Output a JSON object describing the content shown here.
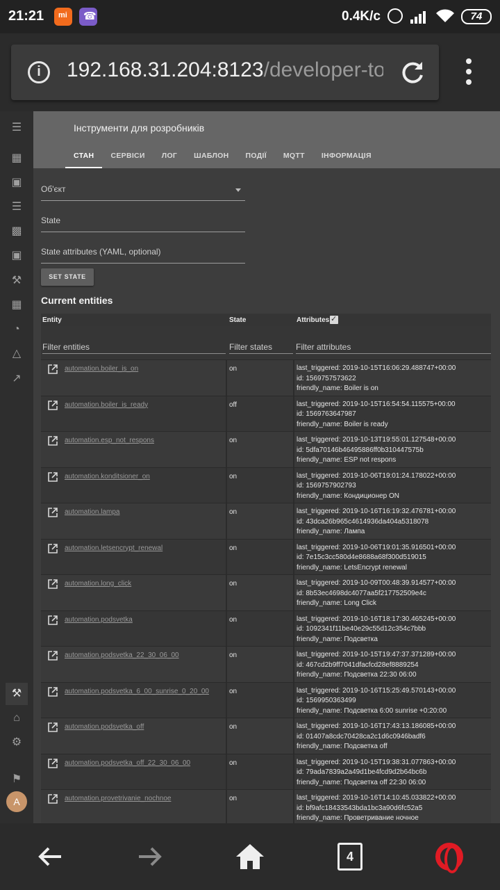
{
  "status_bar": {
    "time": "21:21",
    "net_speed": "0.4K/c",
    "battery": "74"
  },
  "browser": {
    "url_host": "192.168.31.204:8123",
    "url_path": "/developer-to"
  },
  "toolbar": {
    "title": "Інструменти для розробників",
    "tabs": [
      "СТАН",
      "СЕРВІСИ",
      "ЛОГ",
      "ШАБЛОН",
      "ПОДІЇ",
      "MQTT",
      "ІНФОРМАЦІЯ"
    ]
  },
  "form": {
    "entity_label": "Об'єкт",
    "state_label": "State",
    "attributes_label": "State attributes (YAML, optional)",
    "set_state_button": "SET STATE"
  },
  "entities": {
    "title": "Current entities",
    "columns": {
      "entity": "Entity",
      "state": "State",
      "attributes": "Attributes"
    },
    "filters": {
      "entity": "Filter entities",
      "state": "Filter states",
      "attributes": "Filter attributes"
    },
    "rows": [
      {
        "entity": "automation.boiler_is_on",
        "state": "on",
        "attr1": "last_triggered: 2019-10-15T16:06:29.488747+00:00",
        "attr2": "id: 1569757573622",
        "attr3": "friendly_name: Boiler is on"
      },
      {
        "entity": "automation.boiler_is_ready",
        "state": "off",
        "attr1": "last_triggered: 2019-10-15T16:54:54.115575+00:00",
        "attr2": "id: 1569763647987",
        "attr3": "friendly_name: Boiler is ready"
      },
      {
        "entity": "automation.esp_not_respons",
        "state": "on",
        "attr1": "last_triggered: 2019-10-13T19:55:01.127548+00:00",
        "attr2": "id: 5dfa70146b46495886ff0b310447575b",
        "attr3": "friendly_name: ESP not respons"
      },
      {
        "entity": "automation.konditsioner_on",
        "state": "on",
        "attr1": "last_triggered: 2019-10-06T19:01:24.178022+00:00",
        "attr2": "id: 1569757902793",
        "attr3": "friendly_name: Кондиционер ON"
      },
      {
        "entity": "automation.lampa",
        "state": "on",
        "attr1": "last_triggered: 2019-10-16T16:19:32.476781+00:00",
        "attr2": "id: 43dca26b965c4614936da404a5318078",
        "attr3": "friendly_name: Лампа"
      },
      {
        "entity": "automation.letsencrypt_renewal",
        "state": "on",
        "attr1": "last_triggered: 2019-10-06T19:01:35.916501+00:00",
        "attr2": "id: 7e15c3cc580d4e8688a68f300d519015",
        "attr3": "friendly_name: LetsEncrypt renewal"
      },
      {
        "entity": "automation.long_click",
        "state": "on",
        "attr1": "last_triggered: 2019-10-09T00:48:39.914577+00:00",
        "attr2": "id: 8b53ec4698dc4077aa5f217752509e4c",
        "attr3": "friendly_name: Long Click"
      },
      {
        "entity": "automation.podsvetka",
        "state": "on",
        "attr1": "last_triggered: 2019-10-16T18:17:30.465245+00:00",
        "attr2": "id: 1092341f11be40e29c55d12c354c7bbb",
        "attr3": "friendly_name: Подсветка"
      },
      {
        "entity": "automation.podsvetka_22_30_06_00",
        "state": "on",
        "attr1": "last_triggered: 2019-10-15T19:47:37.371289+00:00",
        "attr2": "id: 467cd2b9ff7041dfacfcd28ef8889254",
        "attr3": "friendly_name: Подсветка 22:30 06:00"
      },
      {
        "entity": "automation.podsvetka_6_00_sunrise_0_20_00",
        "state": "on",
        "attr1": "last_triggered: 2019-10-16T15:25:49.570143+00:00",
        "attr2": "id: 1569950363499",
        "attr3": "friendly_name: Подсветка 6:00 sunrise +0:20:00"
      },
      {
        "entity": "automation.podsvetka_off",
        "state": "on",
        "attr1": "last_triggered: 2019-10-16T17:43:13.186085+00:00",
        "attr2": "id: 01407a8cdc70428ca2c1d6c0946badf6",
        "attr3": "friendly_name: Подсветка off"
      },
      {
        "entity": "automation.podsvetka_off_22_30_06_00",
        "state": "on",
        "attr1": "last_triggered: 2019-10-15T19:38:31.077863+00:00",
        "attr2": "id: 79ada7839a2a49d1be4fcd9d2b64bc6b",
        "attr3": "friendly_name: Подсветка off 22:30 06:00"
      },
      {
        "entity": "automation.provetrivanie_nochnoe",
        "state": "on",
        "attr1": "last_triggered: 2019-10-16T14:10:45.033822+00:00",
        "attr2": "id: bf9afc18433543bda1bc3a90d6fc52a5",
        "attr3": "friendly_name: Проветривание ночное"
      }
    ]
  },
  "nav": {
    "tabs_count": "4"
  },
  "user": {
    "avatar_letter": "A"
  }
}
